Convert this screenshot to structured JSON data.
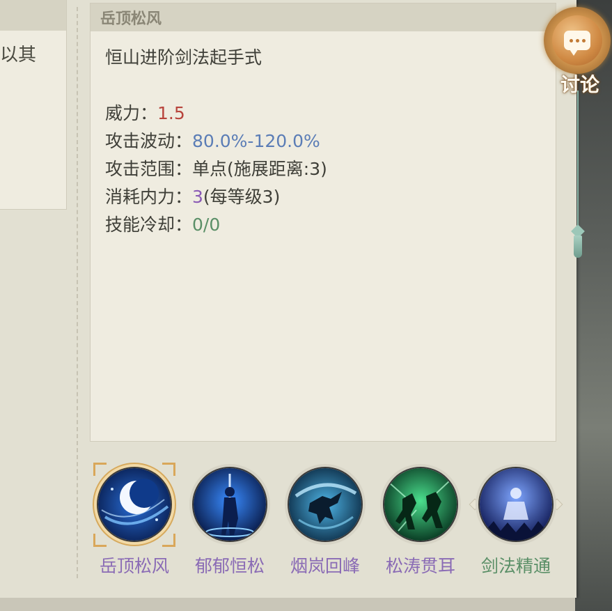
{
  "left_panel": {
    "text": "以其"
  },
  "detail": {
    "title": "岳顶松风",
    "subtitle": "恒山进阶剑法起手式",
    "stats": [
      {
        "label": "威力：",
        "value": "1.5",
        "value_color": "#b8443c"
      },
      {
        "label": "攻击波动：",
        "value": "80.0%-120.0%",
        "value_color": "#5b7db6"
      },
      {
        "label": "攻击范围：",
        "value": "单点(施展距离:3)",
        "value_color": "#3f3f38"
      },
      {
        "label": "消耗内力：",
        "value": "3",
        "value_color": "#8a5ab5",
        "suffix": "(每等级3)"
      },
      {
        "label": "技能冷却：",
        "value": "0/0",
        "value_color": "#5a8f67"
      }
    ]
  },
  "discuss_button": {
    "label": "讨论",
    "icon": "chat-bubble-icon"
  },
  "skills": [
    {
      "name": "岳顶松风",
      "color": "#8a6bb5",
      "icon": "crescent-moon-icon",
      "selected": true
    },
    {
      "name": "郁郁恒松",
      "color": "#8a6bb5",
      "icon": "sword-warrior-icon",
      "selected": false
    },
    {
      "name": "烟岚回峰",
      "color": "#8a6bb5",
      "icon": "spinning-strike-icon",
      "selected": false
    },
    {
      "name": "松涛贯耳",
      "color": "#8a6bb5",
      "icon": "green-duel-icon",
      "selected": false
    },
    {
      "name": "剑法精通",
      "color": "#5a8f67",
      "icon": "meditation-icon",
      "selected": false
    }
  ]
}
